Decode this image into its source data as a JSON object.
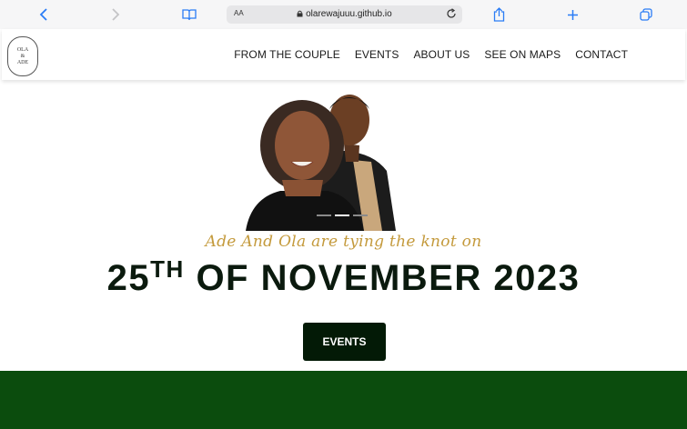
{
  "browser": {
    "url": "olarewajuuu.github.io",
    "text_size_label": "AA"
  },
  "header": {
    "logo_text": [
      "OLA",
      "&",
      "ADE"
    ],
    "nav": [
      {
        "label": "FROM THE COUPLE"
      },
      {
        "label": "EVENTS"
      },
      {
        "label": "ABOUT US"
      },
      {
        "label": "SEE ON MAPS"
      },
      {
        "label": "CONTACT"
      }
    ]
  },
  "hero": {
    "tagline": "Ade And Ola are tying the knot on",
    "date_day": "25",
    "date_suffix": "TH",
    "date_rest": " OF NOVEMBER 2023",
    "button_label": "EVENTS",
    "carousel": {
      "slides": 3,
      "active_index": 1
    }
  },
  "colors": {
    "accent_gold": "#c49a3c",
    "dark_green": "#031a06",
    "band_green": "#0b4c0d"
  }
}
